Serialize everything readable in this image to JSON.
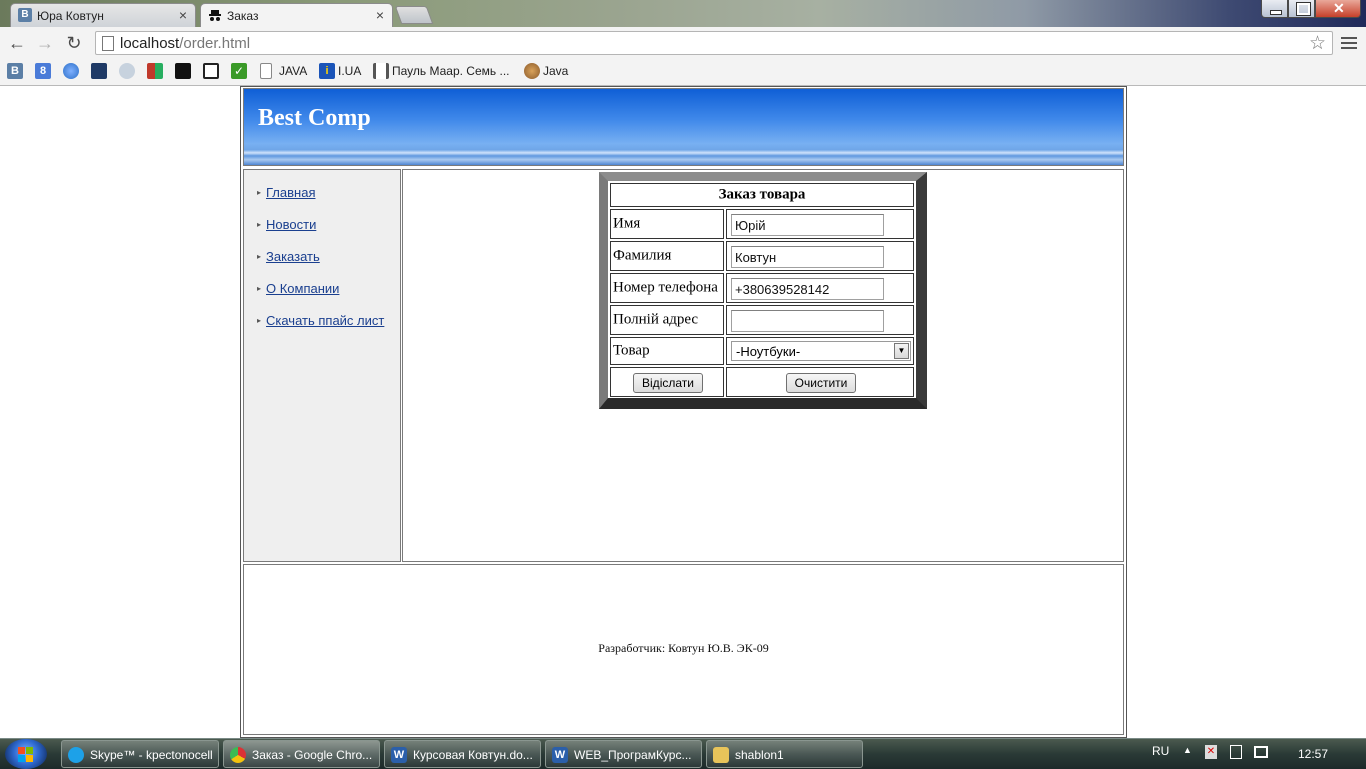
{
  "browser": {
    "tabs": [
      {
        "label": "Юра Ковтун",
        "favicon": "vk-icon",
        "active": false
      },
      {
        "label": "Заказ",
        "favicon": "spy-icon",
        "active": true
      }
    ],
    "address": {
      "host": "localhost",
      "path": "/order.html"
    },
    "bookmarks": [
      {
        "label": "",
        "icon": "vk-icon",
        "color": "#5b7fa6"
      },
      {
        "label": "",
        "icon": "google-icon",
        "color": "#4a7bd8"
      },
      {
        "label": "",
        "icon": "globe-icon",
        "color": "#2b6fc7"
      },
      {
        "label": "",
        "icon": "book-icon",
        "color": "#1f3a66"
      },
      {
        "label": "",
        "icon": "cloud-icon",
        "color": "#8aa0b8"
      },
      {
        "label": "",
        "icon": "puzzle-icon",
        "color": "#c0392b"
      },
      {
        "label": "",
        "icon": "film-icon",
        "color": "#111111"
      },
      {
        "label": "",
        "icon": "mail-icon",
        "color": "#222222"
      },
      {
        "label": "",
        "icon": "check-icon",
        "color": "#3a9a28"
      },
      {
        "label": "JAVA",
        "icon": "page-icon",
        "color": "#ffffff"
      },
      {
        "label": "I.UA",
        "icon": "info-icon",
        "color": "#1b54b8"
      },
      {
        "label": "Пауль Маар. Семь ...",
        "icon": "library-icon",
        "color": "#555555"
      },
      {
        "label": "Java",
        "icon": "coffee-icon",
        "color": "#8a5a2b"
      }
    ]
  },
  "site": {
    "title": "Best Comp",
    "menu": [
      "Главная",
      "Новости",
      "Заказать",
      "О Компании",
      "Скачать ппайс лист"
    ],
    "footer": "Разработчик: Ковтун Ю.В. ЭК-09"
  },
  "form": {
    "title": "Заказ товара",
    "fields": [
      {
        "label": "Имя",
        "value": "Юрій"
      },
      {
        "label": "Фамилия",
        "value": "Ковтун"
      },
      {
        "label": "Номер телефона",
        "value": "+380639528142"
      },
      {
        "label": "Полній адрес",
        "value": ""
      }
    ],
    "product": {
      "label": "Товар",
      "selected": "-Ноутбуки-"
    },
    "submit": "Відіслати",
    "reset": "Очистити"
  },
  "taskbar": {
    "items": [
      {
        "label": "Skype™ - kpectonocell",
        "icon": "skype-icon",
        "color": "#1da1e8"
      },
      {
        "label": "Заказ - Google Chro...",
        "icon": "chrome-icon",
        "color": "#e8b21d"
      },
      {
        "label": "Курсовая Ковтун.do...",
        "icon": "word-icon",
        "color": "#2b5faa"
      },
      {
        "label": "WEB_ПрограмКурс...",
        "icon": "word-icon",
        "color": "#2b5faa"
      },
      {
        "label": "shablon1",
        "icon": "folder-icon",
        "color": "#e8c45a"
      }
    ],
    "lang": "RU",
    "time": "12:57"
  },
  "colors": {
    "header_blue": "#1f6fe0",
    "link": "#1a3f8f",
    "sidebar_bg": "#efefef"
  }
}
